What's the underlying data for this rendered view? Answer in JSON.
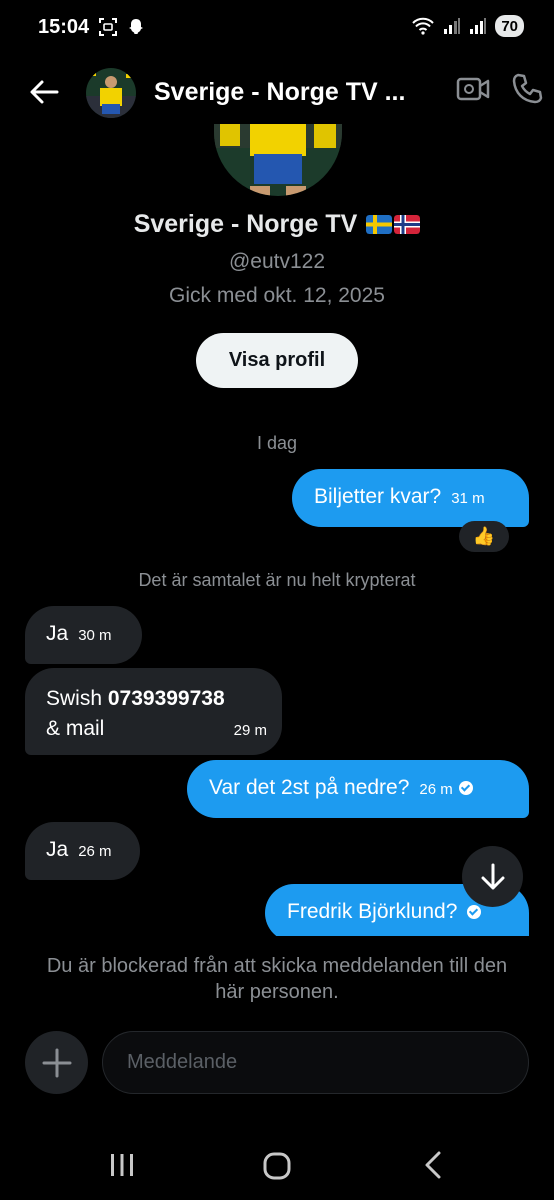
{
  "status_bar": {
    "time": "15:04",
    "battery": "70"
  },
  "header": {
    "title": "Sverige - Norge TV ..."
  },
  "profile": {
    "name": "Sverige - Norge TV",
    "handle": "@eutv122",
    "joined": "Gick med okt. 12, 2025",
    "view_button": "Visa profil"
  },
  "date_divider": "I dag",
  "system_notice": "Det är samtalet är nu helt krypterat",
  "messages": [
    {
      "text": "Biljetter kvar?",
      "time": "31 m"
    },
    {
      "reaction": "👍"
    },
    {
      "text": "Ja",
      "time": "30 m"
    },
    {
      "text_prefix": "Swish ",
      "bold": "0739399738",
      "text_line2": "& mail",
      "time": "29 m"
    },
    {
      "text": "Var det 2st på nedre?",
      "time": "26 m"
    },
    {
      "text": "Ja",
      "time": "26 m"
    },
    {
      "text": "Fredrik Björklund?"
    }
  ],
  "blocked_notice": "Du är blockerad från att skicka meddelanden till den här personen.",
  "composer": {
    "placeholder": "Meddelande"
  },
  "colors": {
    "accent": "#1d9bf0",
    "incoming_bubble": "#202327",
    "muted": "#8b8f94"
  },
  "icons": [
    "back-arrow-icon",
    "video-icon",
    "phone-icon",
    "arrow-down-icon",
    "plus-icon",
    "recents-icon",
    "home-icon",
    "nav-back-icon"
  ]
}
